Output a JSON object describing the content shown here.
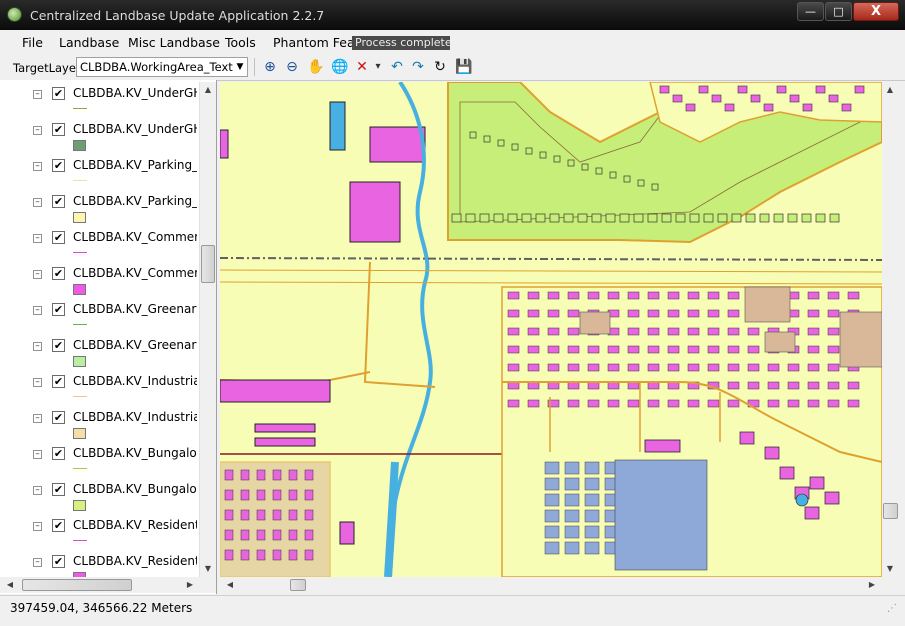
{
  "window": {
    "title": "Centralized Landbase Update Application  2.2.7",
    "controls": {
      "minimize": "—",
      "maximize": "□",
      "close": "X"
    }
  },
  "menu": [
    "File",
    "Landbase",
    "Misc Landbase",
    "Tools",
    "Phantom Featu"
  ],
  "toast": "Process complete ...",
  "toolbar": {
    "target_layer_label": "TargetLayer",
    "target_layer_value": "CLBDBA.WorkingArea_Text",
    "tools": [
      {
        "name": "zoom-in-icon",
        "glyph": "⊕",
        "color": "#1a4f9a"
      },
      {
        "name": "zoom-out-icon",
        "glyph": "⊖",
        "color": "#1a4f9a"
      },
      {
        "name": "pan-hand-icon",
        "glyph": "✋",
        "color": "#333333"
      },
      {
        "name": "globe-full-extent-icon",
        "glyph": "🌐",
        "color": "#2a6ab0"
      },
      {
        "name": "delete-x-icon",
        "glyph": "✕",
        "color": "#d01010"
      },
      {
        "name": "dropdown-arrow-icon",
        "glyph": "▾",
        "color": "#333333"
      },
      {
        "name": "undo-icon",
        "glyph": "↶",
        "color": "#1a7ab0"
      },
      {
        "name": "redo-icon",
        "glyph": "↷",
        "color": "#1a7ab0"
      },
      {
        "name": "refresh-icon",
        "glyph": "↻",
        "color": "#111111"
      },
      {
        "name": "save-disk-icon",
        "glyph": "💾",
        "color": "#1a5fa0"
      }
    ]
  },
  "layers": [
    {
      "label": "CLBDBA.KV_UnderGHw",
      "checked": "✔",
      "expander": "–",
      "symbol": "line",
      "color": "#8aa83a"
    },
    {
      "label": "CLBDBA.KV_UnderGHw",
      "checked": "✔",
      "expander": "–",
      "symbol": "fill",
      "color": "#6e9e72"
    },
    {
      "label": "CLBDBA.KV_Parking_Lo",
      "checked": "✔",
      "expander": "–",
      "symbol": "line",
      "color": "#e8e4a8"
    },
    {
      "label": "CLBDBA.KV_Parking_Lo",
      "checked": "✔",
      "expander": "–",
      "symbol": "fill",
      "color": "#fbf7b0"
    },
    {
      "label": "CLBDBA.KV_Commercia",
      "checked": "✔",
      "expander": "–",
      "symbol": "line",
      "color": "#e044d8"
    },
    {
      "label": "CLBDBA.KV_Commercia",
      "checked": "✔",
      "expander": "–",
      "symbol": "fill",
      "color": "#f05ae8"
    },
    {
      "label": "CLBDBA.KV_Greenary_L",
      "checked": "✔",
      "expander": "–",
      "symbol": "line",
      "color": "#6ab04a"
    },
    {
      "label": "CLBDBA.KV_Greenary_A",
      "checked": "✔",
      "expander": "–",
      "symbol": "fill",
      "color": "#b8f0a0"
    },
    {
      "label": "CLBDBA.KV_Industrial_L",
      "checked": "✔",
      "expander": "–",
      "symbol": "line",
      "color": "#e8c890"
    },
    {
      "label": "CLBDBA.KV_Industrial_A",
      "checked": "✔",
      "expander": "–",
      "symbol": "fill",
      "color": "#f6dea8"
    },
    {
      "label": "CLBDBA.KV_Bungalow_",
      "checked": "✔",
      "expander": "–",
      "symbol": "line",
      "color": "#a8c840"
    },
    {
      "label": "CLBDBA.KV_Bungalow_",
      "checked": "✔",
      "expander": "–",
      "symbol": "fill",
      "color": "#d8f080"
    },
    {
      "label": "CLBDBA.KV_Residential_",
      "checked": "✔",
      "expander": "–",
      "symbol": "line",
      "color": "#e848d8"
    },
    {
      "label": "CLBDBA.KV_Residential_",
      "checked": "✔",
      "expander": "–",
      "symbol": "fill",
      "color": "#f05ae8"
    }
  ],
  "map_colors": {
    "background": "#f8fdb6",
    "residential": "#e864e0",
    "bungalow": "#c6ee78",
    "industrial": "#d8b898",
    "road": "#e0a030",
    "water": "#48b0e0",
    "parking": "#8ea8d8",
    "rail": "#606060",
    "boundary": "#8a1a1a"
  },
  "status": {
    "coordinates": "397459.04, 346566.22",
    "units": "Meters"
  },
  "scrollbars": {
    "up": "▲",
    "down": "▼",
    "left": "◀",
    "right": "▶"
  }
}
